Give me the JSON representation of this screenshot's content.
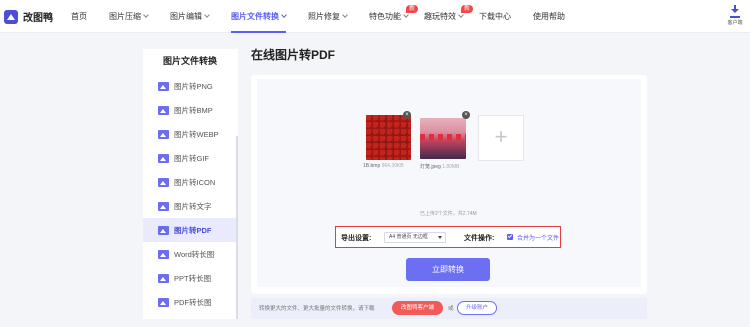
{
  "brand": {
    "name": "改图鸭"
  },
  "nav": {
    "items": [
      {
        "label": "首页"
      },
      {
        "label": "图片压缩"
      },
      {
        "label": "图片编辑"
      },
      {
        "label": "图片文件转换"
      },
      {
        "label": "照片修复"
      },
      {
        "label": "特色功能"
      },
      {
        "label": "趣玩特效"
      },
      {
        "label": "下载中心"
      },
      {
        "label": "使用帮助"
      }
    ],
    "badge": "新",
    "client_label": "客户端"
  },
  "sidebar": {
    "title": "图片文件转换",
    "items": [
      {
        "label": "图片转PNG"
      },
      {
        "label": "图片转BMP"
      },
      {
        "label": "图片转WEBP"
      },
      {
        "label": "图片转GIF"
      },
      {
        "label": "图片转ICON"
      },
      {
        "label": "图片转文字"
      },
      {
        "label": "图片转PDF"
      },
      {
        "label": "Word转长图"
      },
      {
        "label": "PPT转长图"
      },
      {
        "label": "PDF转长图"
      }
    ]
  },
  "main": {
    "title": "在线图片转PDF",
    "files": [
      {
        "name": "1B.bmp",
        "size": "964.30KB"
      },
      {
        "name": "灯笼.jpeg",
        "size": "1.80MB"
      }
    ],
    "remove_glyph": "×",
    "add_glyph": "+",
    "upload_summary": "已上传2个文件，共2.74M",
    "export_label": "导出设置:",
    "export_value": "A4 普通页 无边框",
    "file_op_label": "文件操作:",
    "merge_label": "合并为一个文件",
    "convert_label": "立即转换"
  },
  "footer": {
    "text": "转换更大的文件、更大批量的文件转换，请下载",
    "client_button": "改图鸭客户端",
    "or": "或",
    "upgrade_button": "升级账户"
  },
  "colors": {
    "accent": "#5b5ff0",
    "highlight": "#e23c3c",
    "badge": "#f04848"
  }
}
